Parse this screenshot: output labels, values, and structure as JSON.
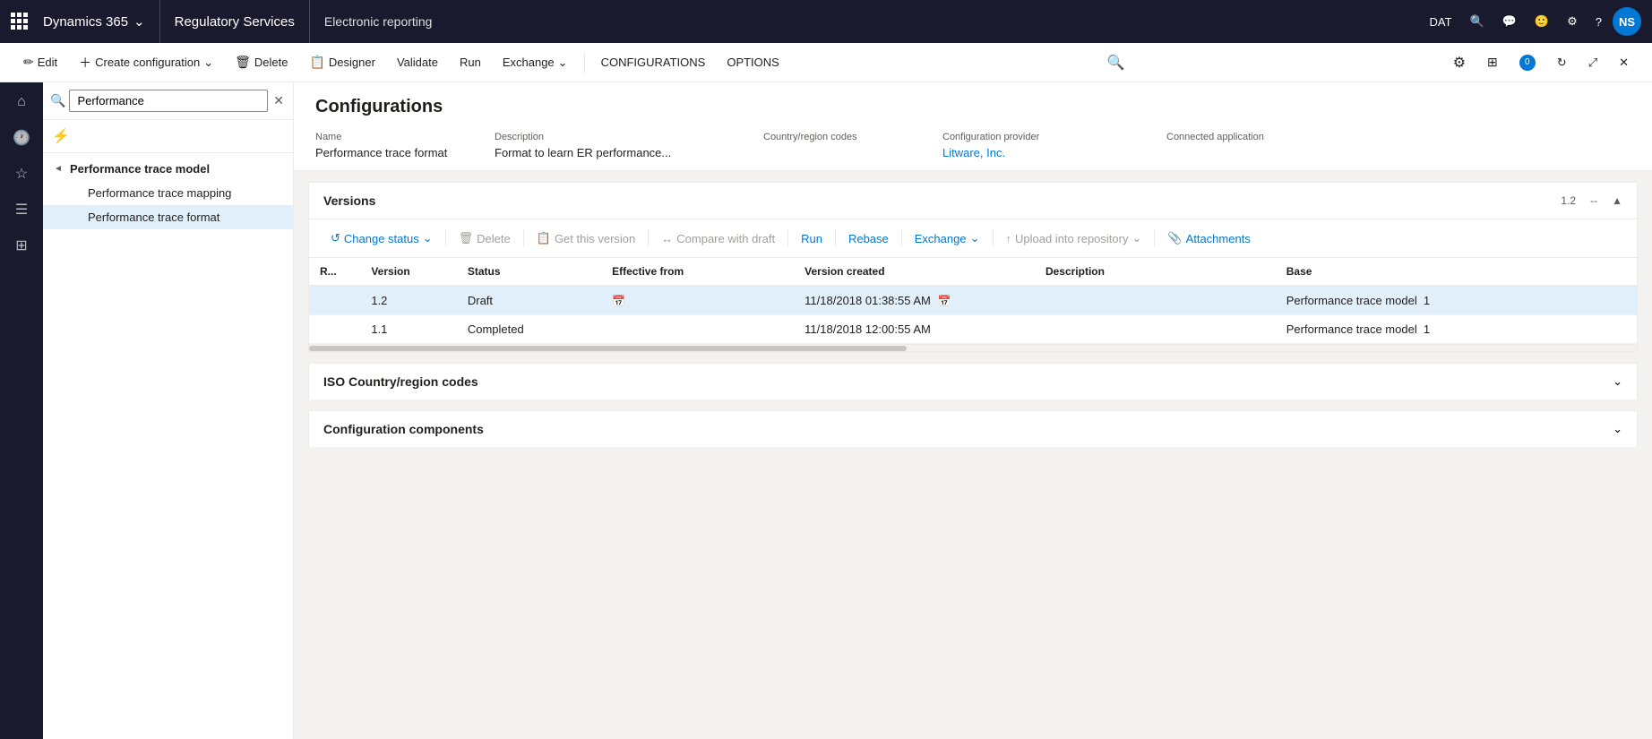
{
  "topnav": {
    "brand": "Dynamics 365",
    "chevron": "∨",
    "module": "Regulatory Services",
    "page": "Electronic reporting",
    "dat": "DAT",
    "user_initials": "NS"
  },
  "commandbar": {
    "edit": "Edit",
    "create_configuration": "Create configuration",
    "delete": "Delete",
    "designer": "Designer",
    "validate": "Validate",
    "run": "Run",
    "exchange": "Exchange",
    "configurations": "CONFIGURATIONS",
    "options": "OPTIONS"
  },
  "tree": {
    "search_placeholder": "Performance",
    "items": [
      {
        "level": 0,
        "label": "Performance trace model",
        "expand": "◄",
        "has_children": true
      },
      {
        "level": 1,
        "label": "Performance trace mapping",
        "expand": "",
        "has_children": false
      },
      {
        "level": 1,
        "label": "Performance trace format",
        "expand": "",
        "has_children": false,
        "selected": true
      }
    ]
  },
  "config": {
    "title": "Configurations",
    "name_label": "Name",
    "name_value": "Performance trace format",
    "description_label": "Description",
    "description_value": "Format to learn ER performance...",
    "country_label": "Country/region codes",
    "country_value": "",
    "provider_label": "Configuration provider",
    "provider_value": "Litware, Inc.",
    "connected_label": "Connected application",
    "connected_value": ""
  },
  "versions": {
    "section_title": "Versions",
    "version_display": "1.2",
    "dash": "--",
    "toolbar": {
      "change_status": "Change status",
      "delete": "Delete",
      "get_this_version": "Get this version",
      "compare_with_draft": "Compare with draft",
      "run": "Run",
      "rebase": "Rebase",
      "exchange": "Exchange",
      "upload_into_repository": "Upload into repository",
      "attachments": "Attachments"
    },
    "columns": {
      "r": "R...",
      "version": "Version",
      "status": "Status",
      "effective_from": "Effective from",
      "version_created": "Version created",
      "description": "Description",
      "base": "Base"
    },
    "rows": [
      {
        "r": "",
        "version": "1.2",
        "status": "Draft",
        "effective_from_icon": true,
        "effective_from": "",
        "version_created": "11/18/2018 01:38:55 AM",
        "version_created_icon": true,
        "description": "",
        "base": "Performance trace model",
        "base_num": "1",
        "selected": true,
        "base_link": true
      },
      {
        "r": "",
        "version": "1.1",
        "status": "Completed",
        "effective_from_icon": false,
        "effective_from": "",
        "version_created": "11/18/2018 12:00:55 AM",
        "version_created_icon": false,
        "description": "",
        "base": "Performance trace model",
        "base_num": "1",
        "selected": false,
        "base_link": false
      }
    ]
  },
  "iso_section": {
    "title": "ISO Country/region codes"
  },
  "config_components_section": {
    "title": "Configuration components"
  }
}
